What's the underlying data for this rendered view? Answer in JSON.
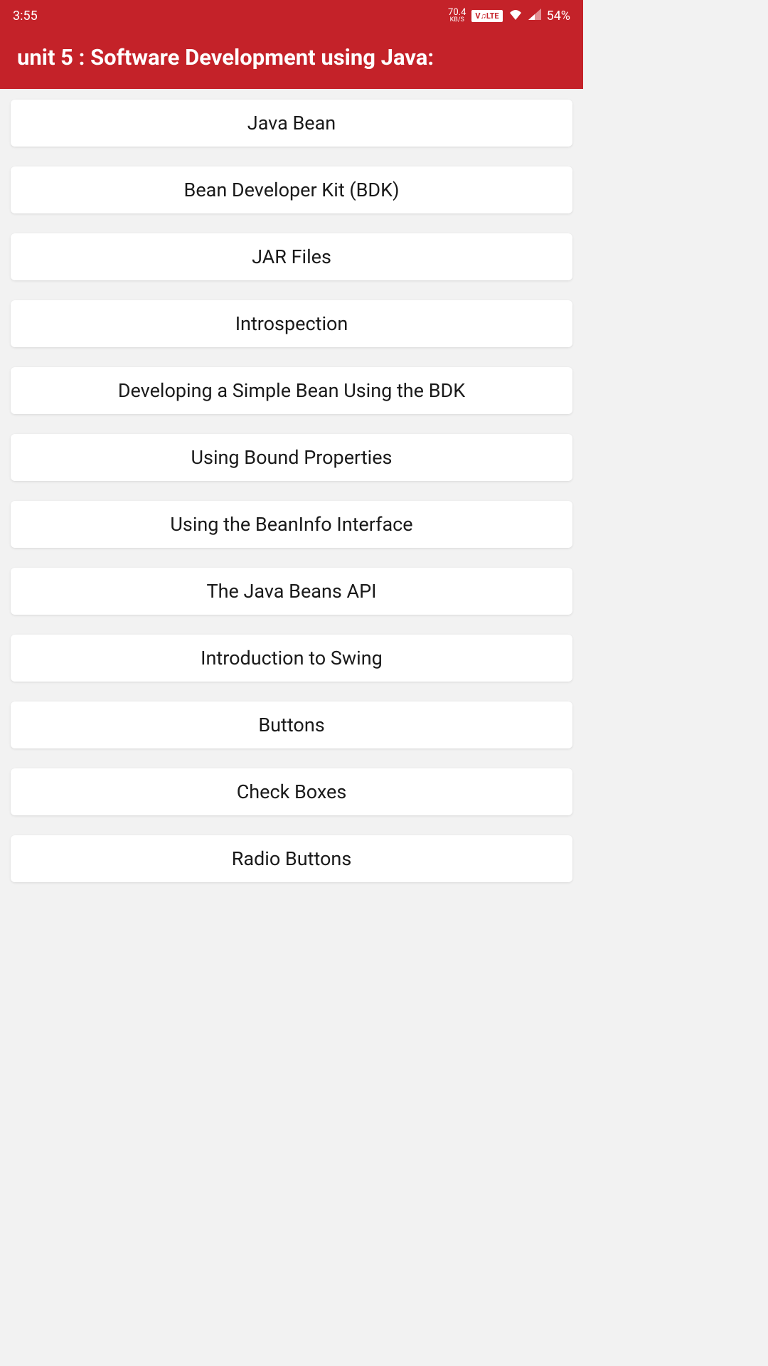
{
  "statusBar": {
    "time": "3:55",
    "netSpeedValue": "70.4",
    "netSpeedUnit": "KB/S",
    "volte": "V♫LTE",
    "battery": "54%"
  },
  "header": {
    "title": "unit 5 : Software Development using Java:"
  },
  "topics": [
    {
      "label": "Java Bean"
    },
    {
      "label": "Bean Developer Kit (BDK)"
    },
    {
      "label": "JAR Files"
    },
    {
      "label": "Introspection"
    },
    {
      "label": "Developing a Simple Bean Using the BDK"
    },
    {
      "label": "Using Bound Properties"
    },
    {
      "label": "Using the BeanInfo Interface"
    },
    {
      "label": "The Java Beans API"
    },
    {
      "label": "Introduction to Swing"
    },
    {
      "label": "Buttons"
    },
    {
      "label": "Check Boxes"
    },
    {
      "label": "Radio Buttons"
    }
  ]
}
